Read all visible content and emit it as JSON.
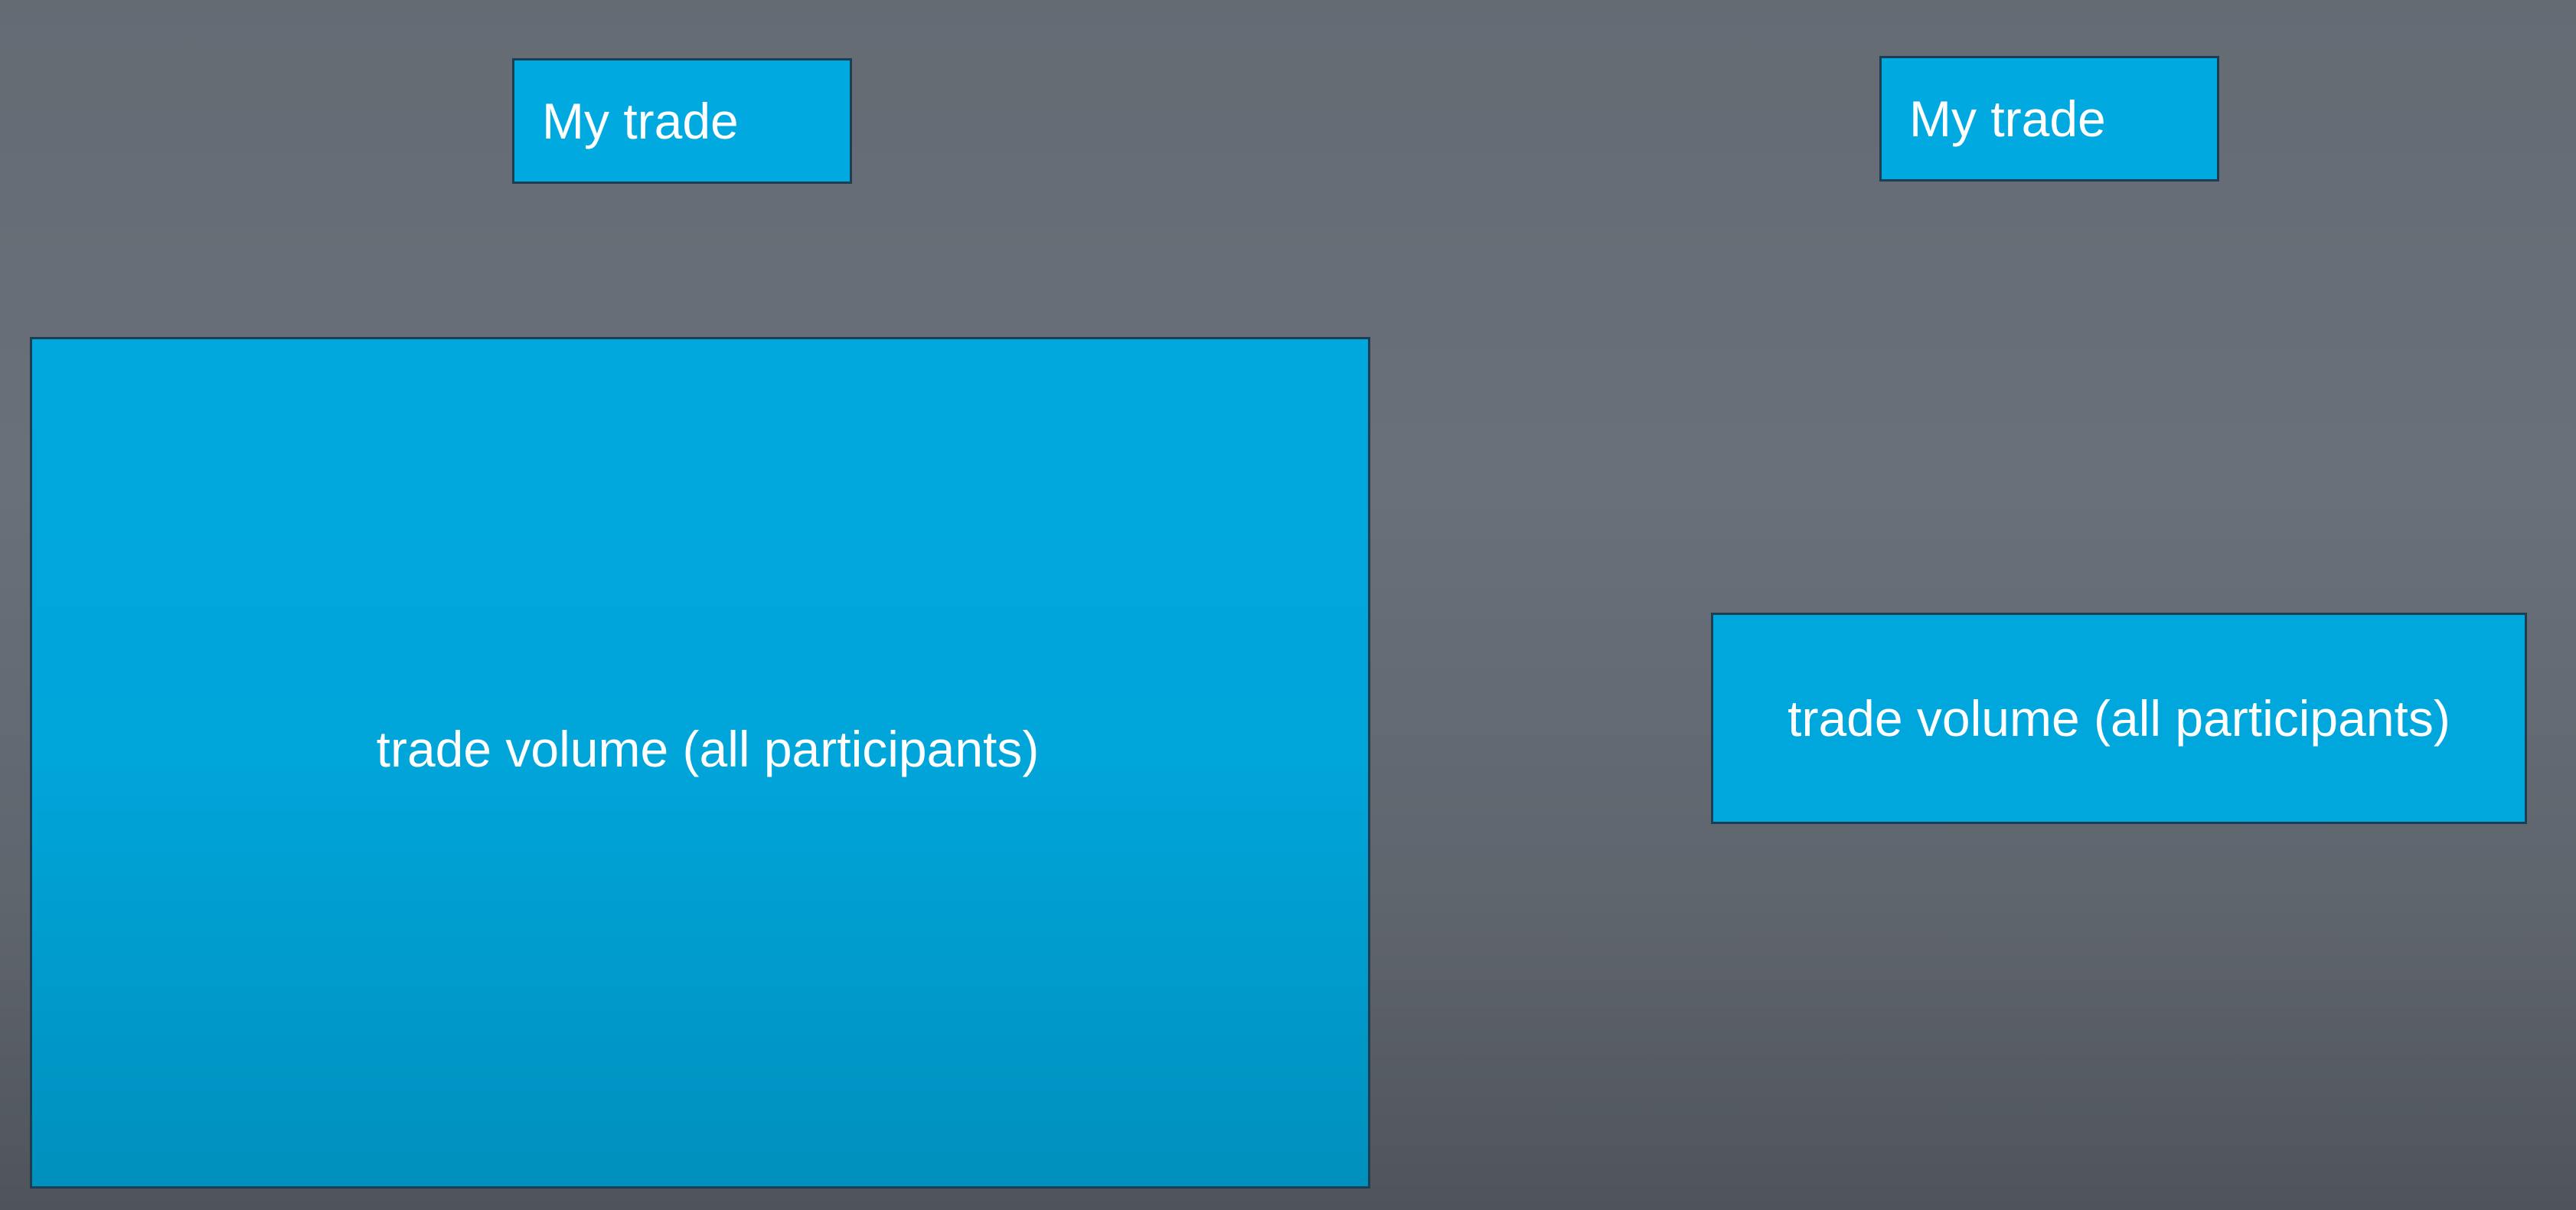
{
  "left": {
    "my_trade_label": "My trade",
    "volume_label": "trade volume (all participants)"
  },
  "right": {
    "my_trade_label": "My trade",
    "volume_label": "trade volume (all participants)"
  },
  "colors": {
    "box_fill": "#00a9df",
    "box_border": "#1d3d52",
    "background": "#676d76",
    "text": "#ffffff"
  }
}
